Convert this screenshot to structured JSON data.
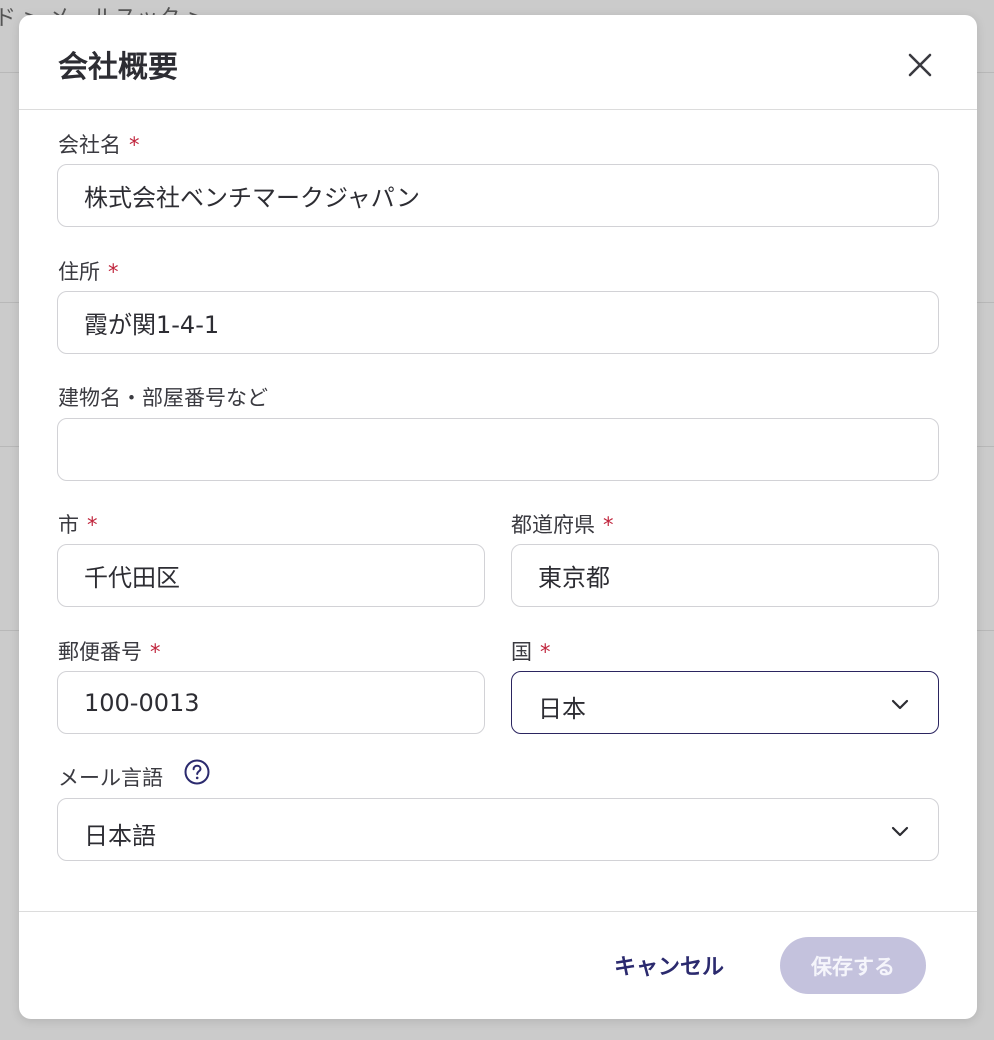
{
  "background": {
    "breadcrumb": "ド > メールスック >"
  },
  "modal": {
    "title": "会社概要",
    "close_icon": "close-icon"
  },
  "fields": {
    "company_name": {
      "label": "会社名",
      "required": "*",
      "value": "株式会社ベンチマークジャパン"
    },
    "address": {
      "label": "住所",
      "required": "*",
      "value": "霞が関1-4-1"
    },
    "building": {
      "label": "建物名・部屋番号など",
      "value": ""
    },
    "city": {
      "label": "市",
      "required": "*",
      "value": "千代田区"
    },
    "prefecture": {
      "label": "都道府県",
      "required": "*",
      "value": "東京都"
    },
    "postal_code": {
      "label": "郵便番号",
      "required": "*",
      "value": "100-0013"
    },
    "country": {
      "label": "国",
      "required": "*",
      "value": "日本"
    },
    "email_language": {
      "label": "メール言語",
      "value": "日本語",
      "help_icon": "question-circle-icon"
    }
  },
  "footer": {
    "cancel_label": "キャンセル",
    "save_label": "保存する"
  },
  "colors": {
    "accent": "#2b2a6e",
    "required": "#c0253d",
    "save_disabled": "#c4c2dd"
  }
}
